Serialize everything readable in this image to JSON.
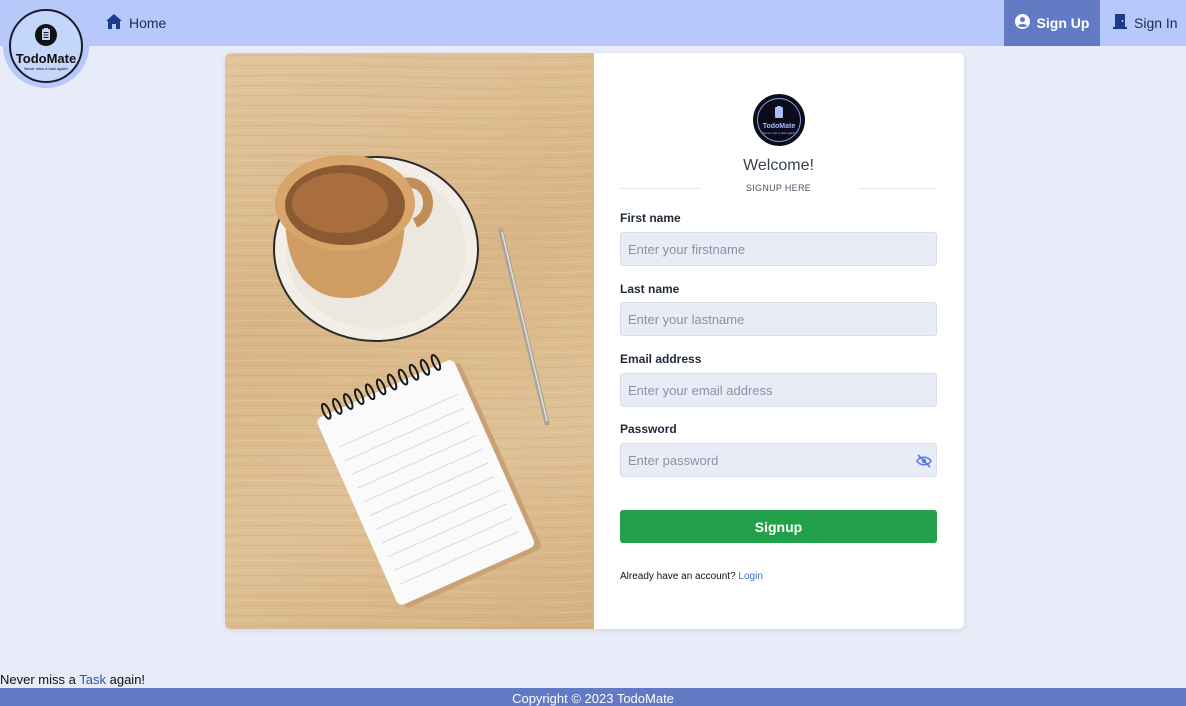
{
  "nav": {
    "logo_name": "TodoMate",
    "logo_tagline": "Never miss a task again!",
    "home_label": "Home",
    "signup_label": "Sign Up",
    "signin_label": "Sign In"
  },
  "form": {
    "avatar_name": "TodoMate",
    "avatar_tagline": "Never miss a task again!",
    "welcome": "Welcome!",
    "subtitle": "SIGNUP HERE",
    "first_name_label": "First name",
    "first_name_placeholder": "Enter your firstname",
    "last_name_label": "Last name",
    "last_name_placeholder": "Enter your lastname",
    "email_label": "Email address",
    "email_placeholder": "Enter your email address",
    "password_label": "Password",
    "password_placeholder": "Enter password",
    "submit_label": "Signup",
    "already_text": "Already have an account?",
    "login_link": "Login"
  },
  "tagline": {
    "before": "Never miss a",
    "highlight": "Task",
    "after": "again!"
  },
  "footer": {
    "copyright": "Copyright © 2023 TodoMate"
  },
  "colors": {
    "nav_bg": "#b6c9fa",
    "active_nav": "#6279c4",
    "signup_button": "#22a04a",
    "page_bg": "#e7ecf8",
    "link": "#3b6fd6"
  },
  "icons": [
    "home-icon",
    "user-circle-icon",
    "door-icon",
    "eye-slash-icon",
    "clipboard-icon"
  ]
}
